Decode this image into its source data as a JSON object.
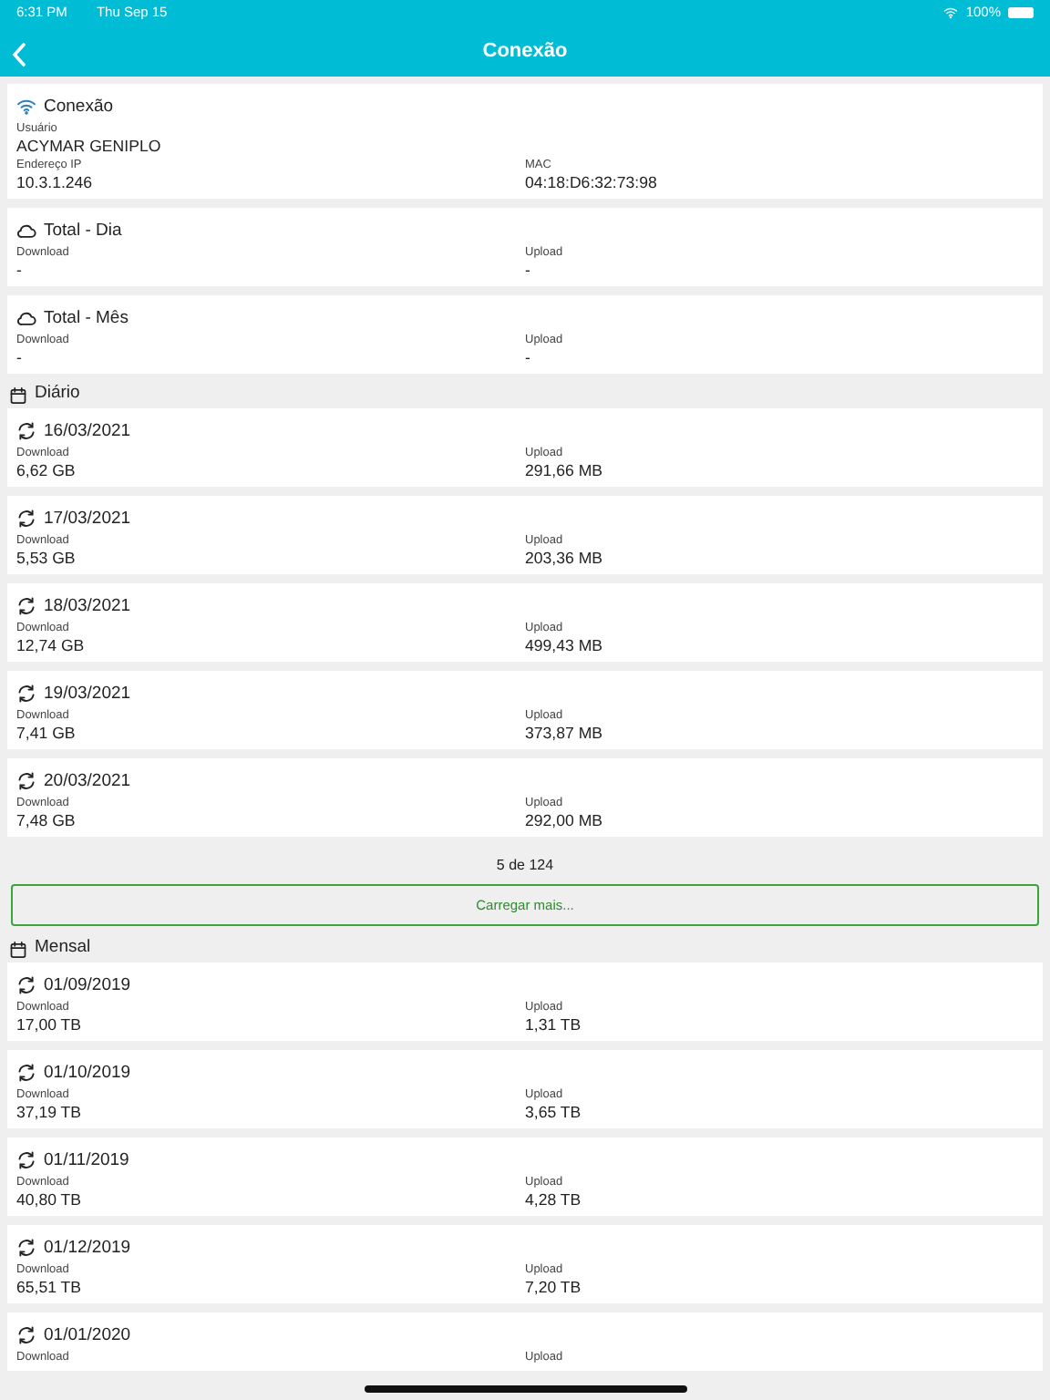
{
  "status_bar": {
    "time": "6:31 PM",
    "date": "Thu Sep 15",
    "battery": "100%"
  },
  "nav": {
    "title": "Conexão"
  },
  "connection": {
    "title": "Conexão",
    "user_label": "Usuário",
    "user": "ACYMAR GENIPLO",
    "fields": [
      {
        "label": "Endereço IP",
        "value": "10.3.1.246"
      },
      {
        "label": "MAC",
        "value": "04:18:D6:32:73:98"
      }
    ]
  },
  "totals": [
    {
      "title": "Total - Dia",
      "download_label": "Download",
      "download": "-",
      "upload_label": "Upload",
      "upload": "-"
    },
    {
      "title": "Total - Mês",
      "download_label": "Download",
      "download": "-",
      "upload_label": "Upload",
      "upload": "-"
    }
  ],
  "sections": [
    {
      "title": "Diário",
      "entries": [
        {
          "date": "16/03/2021",
          "download_label": "Download",
          "download": "6,62 GB",
          "upload_label": "Upload",
          "upload": "291,66 MB"
        },
        {
          "date": "17/03/2021",
          "download_label": "Download",
          "download": "5,53 GB",
          "upload_label": "Upload",
          "upload": "203,36 MB"
        },
        {
          "date": "18/03/2021",
          "download_label": "Download",
          "download": "12,74 GB",
          "upload_label": "Upload",
          "upload": "499,43 MB"
        },
        {
          "date": "19/03/2021",
          "download_label": "Download",
          "download": "7,41 GB",
          "upload_label": "Upload",
          "upload": "373,87 MB"
        },
        {
          "date": "20/03/2021",
          "download_label": "Download",
          "download": "7,48 GB",
          "upload_label": "Upload",
          "upload": "292,00 MB"
        }
      ],
      "count": "5 de 124",
      "load_more": "Carregar mais..."
    },
    {
      "title": "Mensal",
      "entries": [
        {
          "date": "01/09/2019",
          "download_label": "Download",
          "download": "17,00 TB",
          "upload_label": "Upload",
          "upload": "1,31 TB"
        },
        {
          "date": "01/10/2019",
          "download_label": "Download",
          "download": "37,19 TB",
          "upload_label": "Upload",
          "upload": "3,65 TB"
        },
        {
          "date": "01/11/2019",
          "download_label": "Download",
          "download": "40,80 TB",
          "upload_label": "Upload",
          "upload": "4,28 TB"
        },
        {
          "date": "01/12/2019",
          "download_label": "Download",
          "download": "65,51 TB",
          "upload_label": "Upload",
          "upload": "7,20 TB"
        },
        {
          "date": "01/01/2020",
          "download_label": "Download",
          "upload_label": "Upload"
        }
      ]
    }
  ]
}
